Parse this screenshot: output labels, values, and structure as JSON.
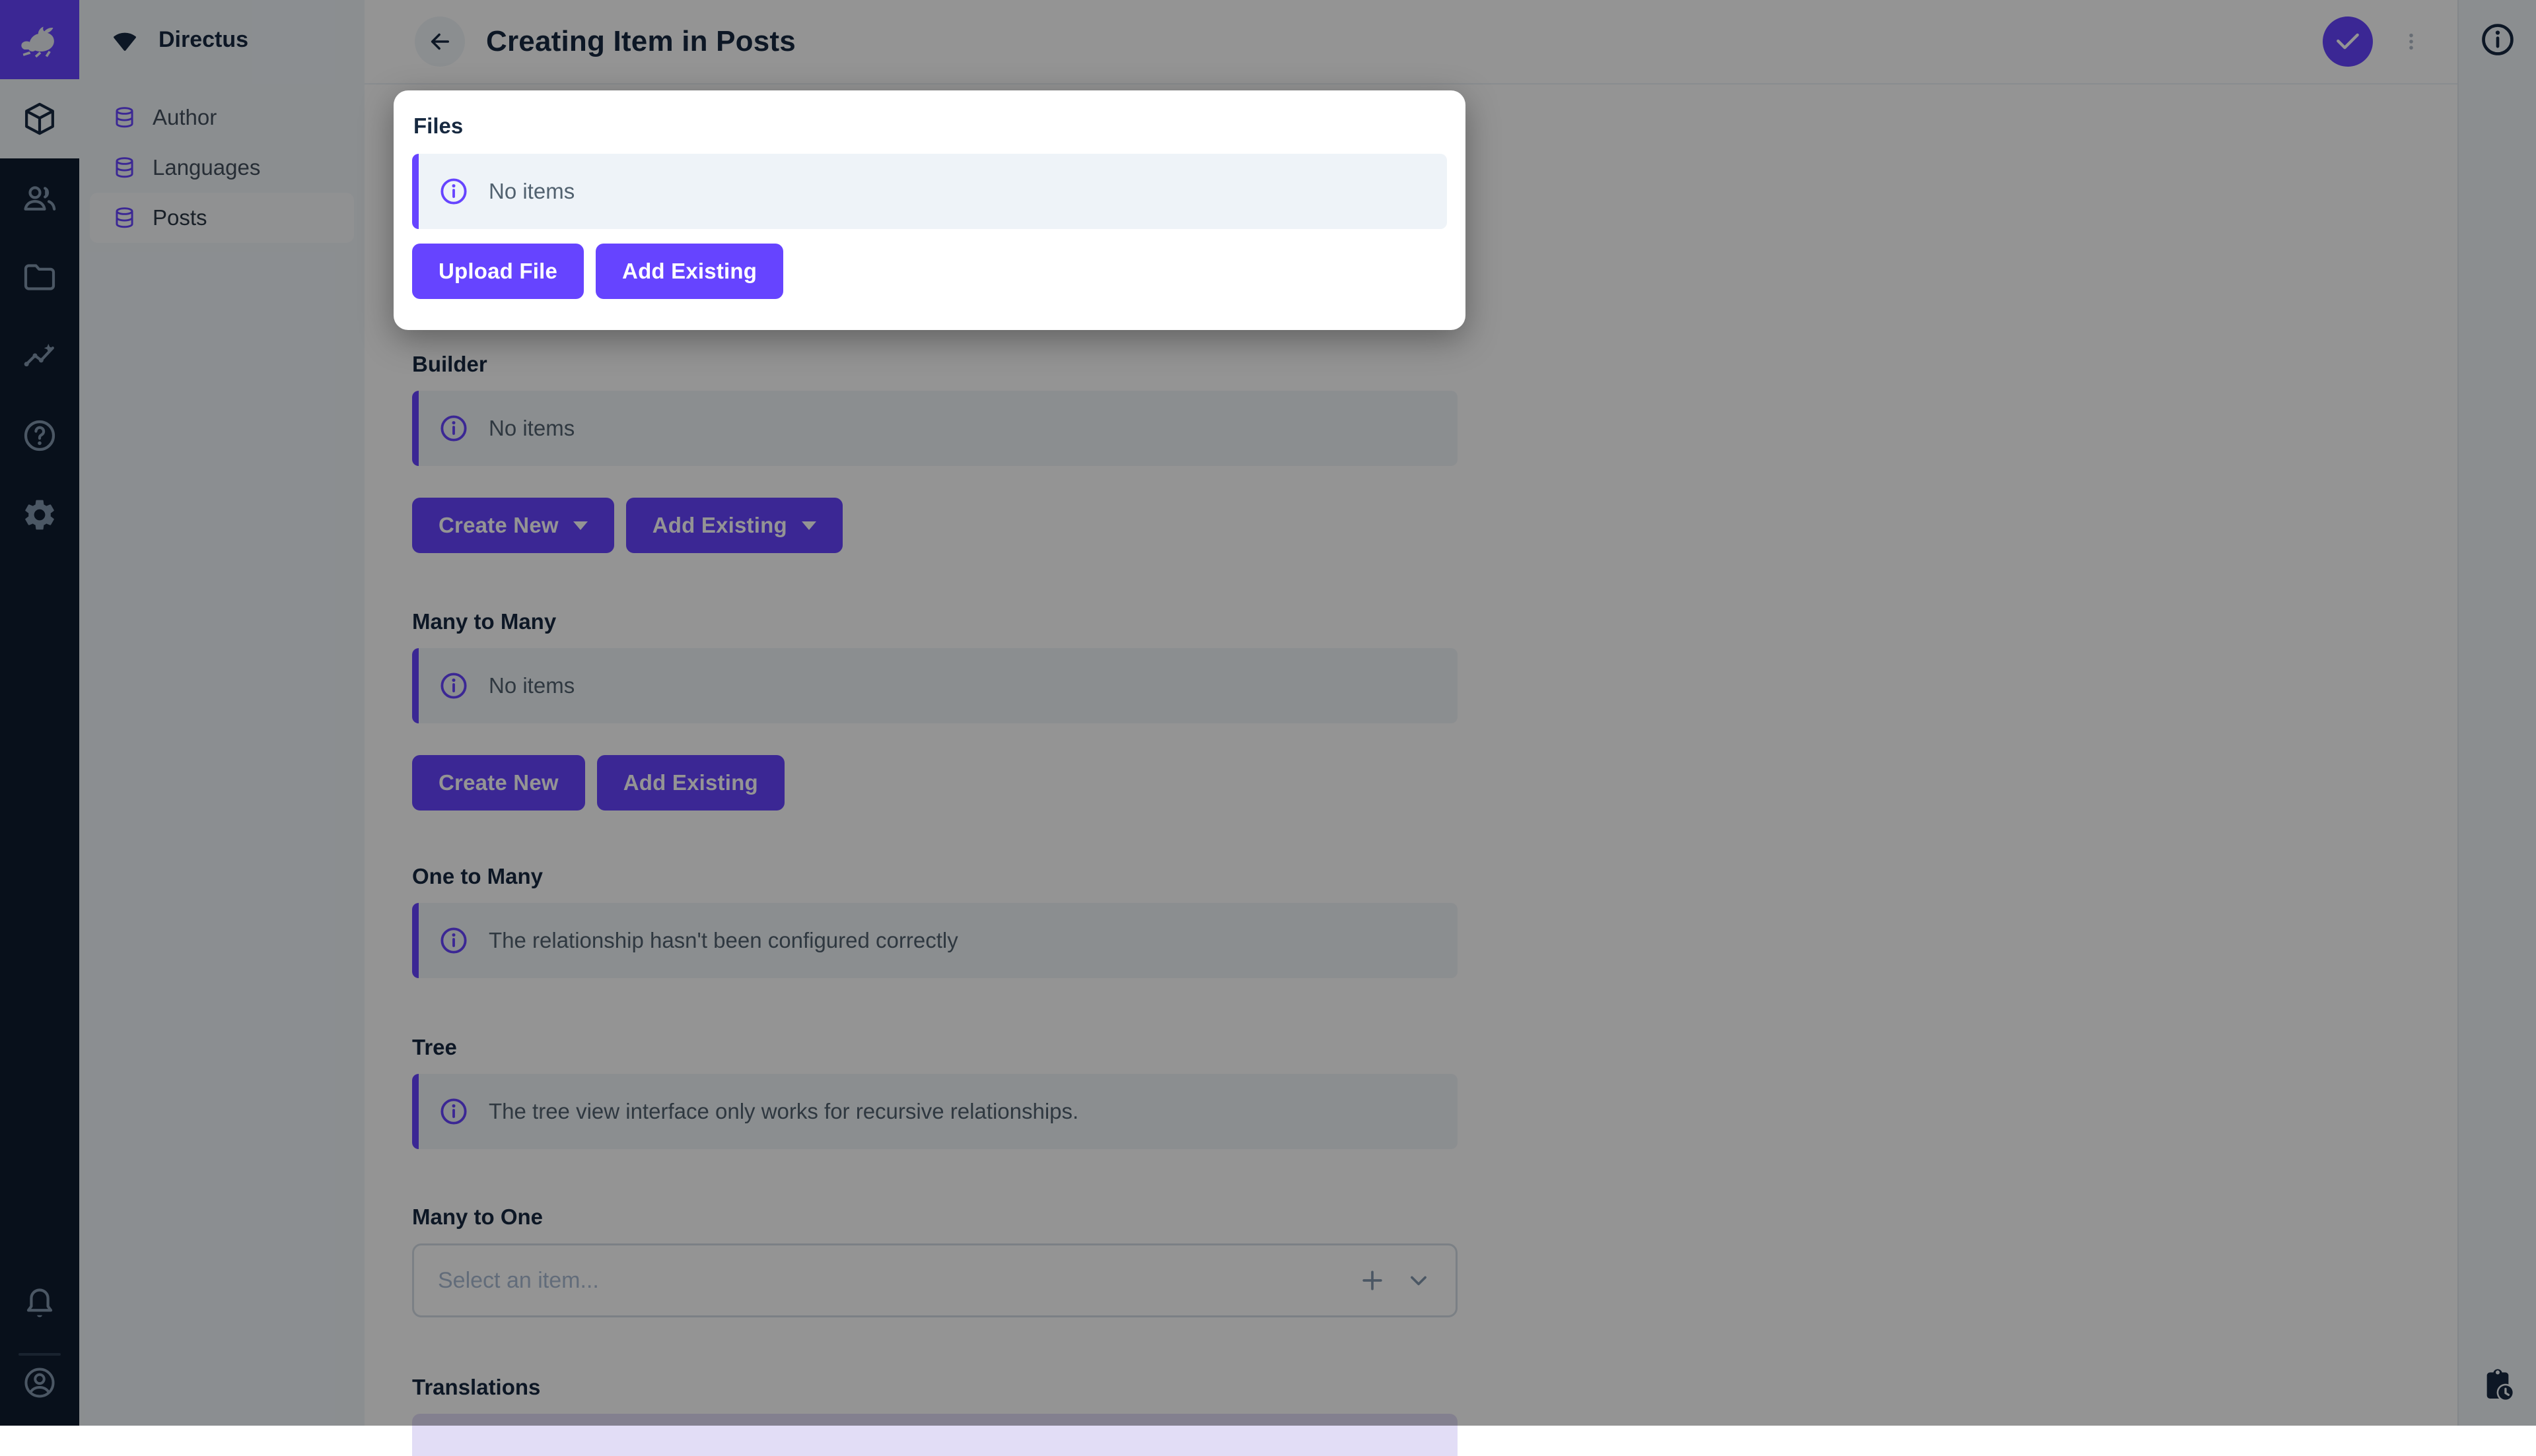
{
  "colors": {
    "accent": "#6644ff",
    "module_bar_bg": "#0e1c2f",
    "nav_bg": "#f0f4f9",
    "title_text": "#172940",
    "notice_bg": "#f0f4f9",
    "notice_text": "#51616f",
    "overlay": "rgba(0,0,0,0.42)",
    "icon_muted": "#8296ad"
  },
  "project": {
    "name": "Directus"
  },
  "module_bar": {
    "items": [
      "box-icon",
      "people-icon",
      "folder-icon",
      "insights-icon",
      "help-icon",
      "settings-icon"
    ],
    "bottom_items": [
      "bell-icon",
      "account-circle-icon"
    ]
  },
  "nav": {
    "items": [
      {
        "label": "Author",
        "active": false
      },
      {
        "label": "Languages",
        "active": false
      },
      {
        "label": "Posts",
        "active": true
      }
    ]
  },
  "header": {
    "title": "Creating Item in Posts"
  },
  "right_rail": {
    "icons": [
      "info-icon",
      "clipboard-clock-icon"
    ]
  },
  "spotlight_card": {
    "label": "Files",
    "notice": "No items",
    "buttons": [
      "Upload File",
      "Add Existing"
    ]
  },
  "sections": {
    "builder": {
      "label": "Builder",
      "notice": "No items",
      "buttons": [
        {
          "label": "Create New",
          "dropdown": true
        },
        {
          "label": "Add Existing",
          "dropdown": true
        }
      ]
    },
    "many_to_many": {
      "label": "Many to Many",
      "notice": "No items",
      "buttons": [
        {
          "label": "Create New",
          "dropdown": false
        },
        {
          "label": "Add Existing",
          "dropdown": false
        }
      ]
    },
    "one_to_many": {
      "label": "One to Many",
      "notice": "The relationship hasn't been configured correctly"
    },
    "tree": {
      "label": "Tree",
      "notice": "The tree view interface only works for recursive relationships."
    },
    "many_to_one": {
      "label": "Many to One",
      "placeholder": "Select an item..."
    },
    "translations": {
      "label": "Translations"
    }
  }
}
